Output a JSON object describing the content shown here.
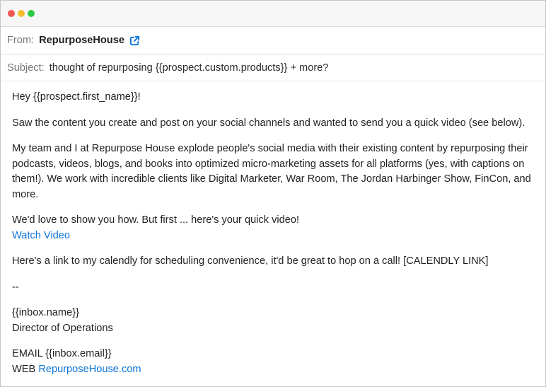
{
  "window": {
    "controls": [
      "close",
      "minimize",
      "zoom"
    ]
  },
  "header": {
    "from_label": "From:",
    "sender_name": "RepurposeHouse",
    "sender_icon": "external-link-icon",
    "subject_label": "Subject:",
    "subject": "thought of repurposing {{prospect.custom.products}} + more?"
  },
  "email_body": {
    "greeting": "Hey {{prospect.first_name}}!",
    "para1": "Saw the content you create and post on your social channels and wanted to send you a quick video (see below).",
    "para2": "My team and I at Repurpose House explode people's social media with their existing content by repurposing their podcasts, videos, blogs, and books into optimized micro-marketing assets for all platforms (yes, with captions on them!). We work with incredible clients like Digital Marketer, War Room, The Jordan Harbinger Show, FinCon, and more.",
    "para3": "We'd love to show you how. But first ... here's your quick video!",
    "watch_video_link": "Watch Video",
    "para4": "Here's a link to my calendly for scheduling convenience, it'd be great to hop on a call! [CALENDLY LINK]",
    "separator": "--",
    "sig_name": "{{inbox.name}}",
    "sig_title": "Director of Operations",
    "email_line": "EMAIL {{inbox.email}}",
    "web_label": "WEB",
    "web_link": "RepurposeHouse.com"
  },
  "colors": {
    "link": "#0a73d8",
    "label_gray": "#777777",
    "close": "#ee5a52",
    "minimize": "#f5bd2e",
    "zoom": "#2fc843"
  }
}
